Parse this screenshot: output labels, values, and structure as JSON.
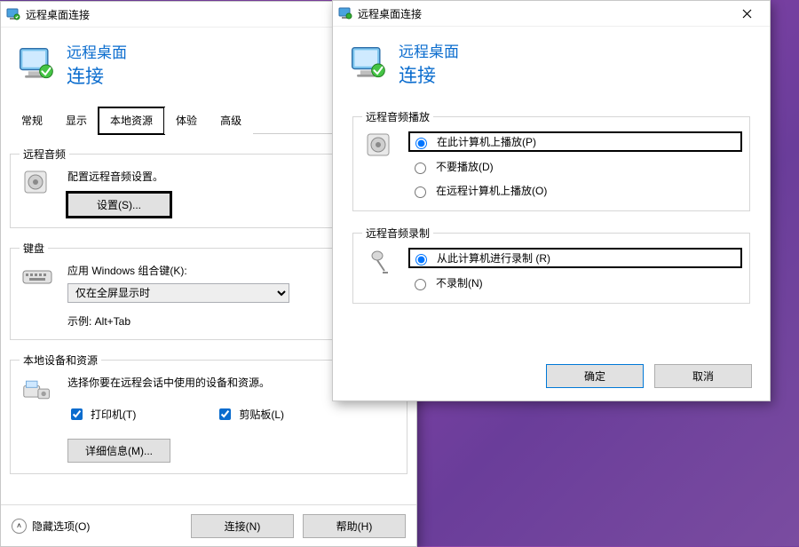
{
  "app_title": "远程桌面连接",
  "header": {
    "line1": "远程桌面",
    "line2": "连接"
  },
  "tabs": {
    "general": "常规",
    "display": "显示",
    "local": "本地资源",
    "experience": "体验",
    "advanced": "高级"
  },
  "audio_group": {
    "legend": "远程音频",
    "desc": "配置远程音频设置。",
    "settings_btn": "设置(S)..."
  },
  "keyboard_group": {
    "legend": "键盘",
    "desc": "应用 Windows 组合键(K):",
    "combo_value": "仅在全屏显示时",
    "example": "示例: Alt+Tab"
  },
  "localdev_group": {
    "legend": "本地设备和资源",
    "desc": "选择你要在远程会话中使用的设备和资源。",
    "printer": "打印机(T)",
    "clipboard": "剪贴板(L)",
    "more_btn": "详细信息(M)..."
  },
  "footer": {
    "hide": "隐藏选项(O)",
    "connect": "连接(N)",
    "help": "帮助(H)"
  },
  "audio_dialog": {
    "title": "远程桌面连接",
    "play_legend": "远程音频播放",
    "play_here": "在此计算机上播放(P)",
    "play_none": "不要播放(D)",
    "play_remote": "在远程计算机上播放(O)",
    "rec_legend": "远程音频录制",
    "rec_here": "从此计算机进行录制 (R)",
    "rec_none": "不录制(N)",
    "ok": "确定",
    "cancel": "取消"
  }
}
